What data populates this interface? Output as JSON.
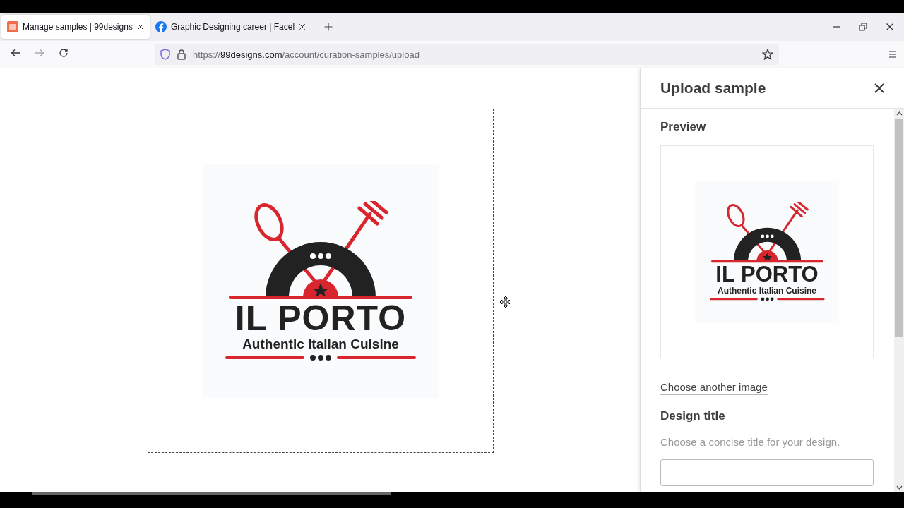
{
  "browser": {
    "tabs": [
      {
        "title": "Manage samples | 99designs",
        "selected": true,
        "kind": "designs"
      },
      {
        "title": "Graphic Designing career | Facel",
        "selected": false,
        "kind": "facebook"
      }
    ],
    "url": {
      "scheme": "https://",
      "host": "99designs.com",
      "path": "/account/curation-samples/upload"
    }
  },
  "canvas": {
    "logo": {
      "name": "IL PORTO",
      "tagline": "Authentic Italian Cuisine"
    }
  },
  "panel": {
    "title": "Upload sample",
    "preview_heading": "Preview",
    "preview_logo": {
      "name": "IL PORTO",
      "tagline": "Authentic Italian Cuisine"
    },
    "choose_link": "Choose another image",
    "design_title_label": "Design title",
    "design_title_hint": "Choose a concise title for your design."
  }
}
